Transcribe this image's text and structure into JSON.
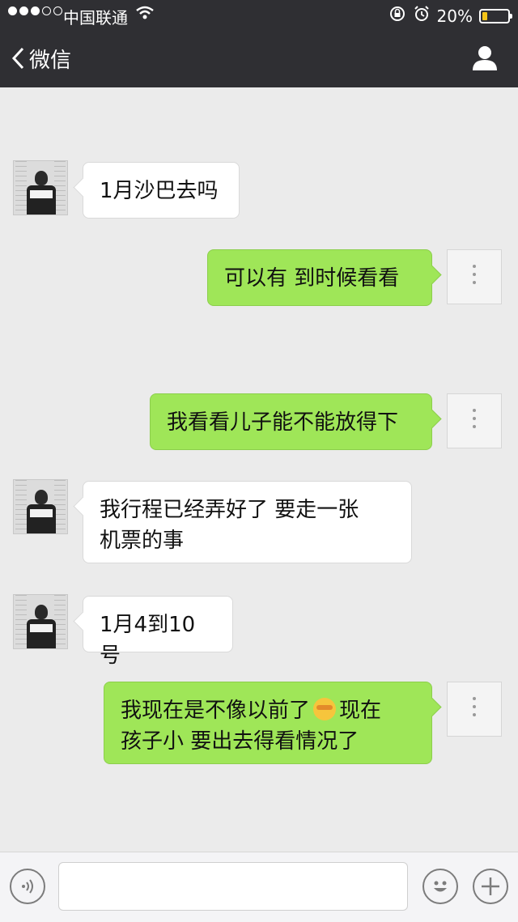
{
  "status_bar": {
    "carrier": "中国联通",
    "battery_percent": "20%",
    "battery_level": 0.2
  },
  "nav": {
    "back_label": "微信"
  },
  "messages": [
    {
      "side": "in",
      "text": "1月沙巴去吗"
    },
    {
      "side": "out",
      "text": "可以有 到时候看看"
    },
    {
      "side": "out",
      "text": "我看看儿子能不能放得下"
    },
    {
      "side": "in",
      "line1": "我行程已经弄好了 要走一张",
      "line2": "机票的事"
    },
    {
      "side": "in",
      "text": "1月4到10号"
    },
    {
      "side": "out",
      "line1_a": "我现在是不像以前了",
      "emoji": "crying-laughing-emoji",
      "line1_b": "现在",
      "line2": "孩子小 要出去得看情况了"
    }
  ],
  "input": {
    "value": "",
    "placeholder": ""
  },
  "icons": [
    "signal-dots-icon",
    "wifi-icon",
    "lock-rotation-icon",
    "alarm-icon",
    "battery-icon",
    "back-chevron-icon",
    "user-icon",
    "voice-icon",
    "emoji-icon",
    "plus-icon"
  ],
  "colors": {
    "nav_bg": "#2f2f33",
    "chat_bg": "#ebebeb",
    "out_bubble": "#9fe658",
    "in_bubble": "#ffffff",
    "battery": "#f5c518"
  }
}
